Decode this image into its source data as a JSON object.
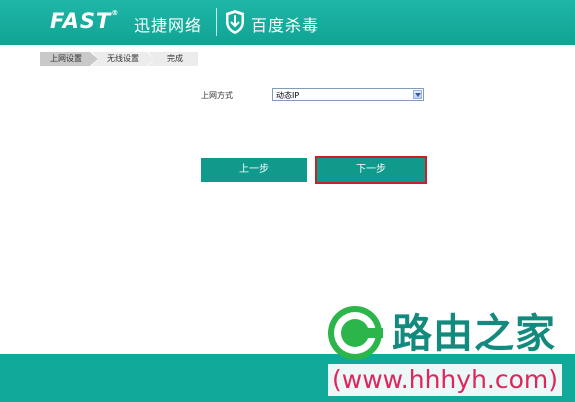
{
  "header": {
    "brand": "FAST",
    "brand_tm": "®",
    "brand_cn": "迅捷网络",
    "partner": "百度杀毒",
    "color": "#13ab9b"
  },
  "steps": [
    {
      "label": "上网设置",
      "active": true
    },
    {
      "label": "无线设置",
      "active": false
    },
    {
      "label": "完成",
      "active": false
    }
  ],
  "form": {
    "connection_label": "上网方式",
    "connection_value": "动态IP"
  },
  "buttons": {
    "prev": "上一步",
    "next": "下一步"
  },
  "watermark": {
    "name": "路由之家",
    "url": "(www.hhhyh.com)"
  }
}
